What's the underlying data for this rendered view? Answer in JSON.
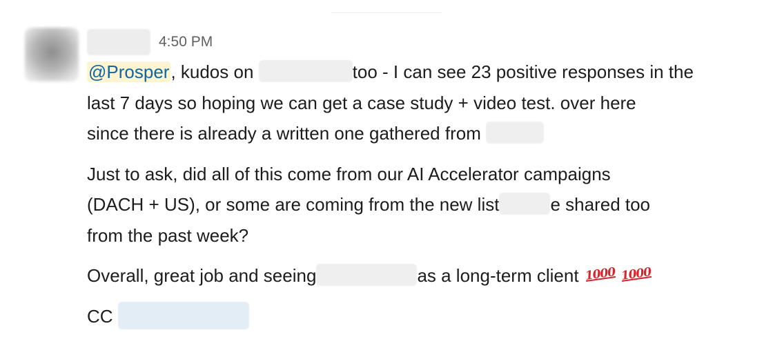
{
  "message": {
    "timestamp": "4:50 PM",
    "mention": "@Prosper",
    "para1": {
      "a": ", kudos on",
      "b": "too - I can see 23 positive responses in the",
      "line2": "last 7 days so hoping we can get a case study + video test. over here",
      "line3": "since there is already a written one gathered from"
    },
    "para2": {
      "line1": "Just to ask, did all of this come from our AI Accelerator campaigns",
      "line2a": "(DACH + US), or some are coming from the new list",
      "line2b": "e shared too",
      "line3": "from the past week?"
    },
    "para3": {
      "a": "Overall, great job and seeing",
      "b": "as a long-term client",
      "emoji": "1000"
    },
    "para4": {
      "cc": "CC"
    }
  },
  "icons": {
    "emoji_name": "100-emoji-icon",
    "emoji_color": "#d8232a",
    "mention_color": "#1264a3",
    "mention_bg": "#fdf4d2"
  }
}
